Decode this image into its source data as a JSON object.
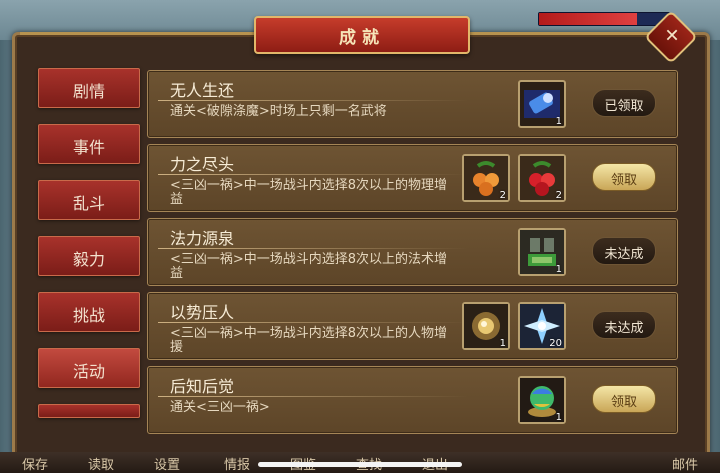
{
  "panel": {
    "title": "成就",
    "close_label": "✕"
  },
  "tabs": [
    {
      "label": "剧情",
      "active": false
    },
    {
      "label": "事件",
      "active": false
    },
    {
      "label": "乱斗",
      "active": false
    },
    {
      "label": "毅力",
      "active": false
    },
    {
      "label": "挑战",
      "active": false
    },
    {
      "label": "活动",
      "active": true
    }
  ],
  "achievements": [
    {
      "title": "无人生还",
      "desc": "通关<破隙涤魔>时场上只剩一名武将",
      "rewards": [
        {
          "icon": "blue-scroll-icon",
          "qty": "1"
        }
      ],
      "status": "已领取"
    },
    {
      "title": "力之尽头",
      "desc": "<三凶一祸>中一场战斗内选择8次以上的物理增益",
      "rewards": [
        {
          "icon": "orange-fruit-icon",
          "qty": "2"
        },
        {
          "icon": "red-fruit-icon",
          "qty": "2"
        }
      ],
      "status": "领取"
    },
    {
      "title": "法力源泉",
      "desc": "<三凶一祸>中一场战斗内选择8次以上的法术增益",
      "rewards": [
        {
          "icon": "green-armor-icon",
          "qty": "1"
        }
      ],
      "status": "未达成"
    },
    {
      "title": "以势压人",
      "desc": "<三凶一祸>中一场战斗内选择8次以上的人物增援",
      "rewards": [
        {
          "icon": "golden-orb-icon",
          "qty": "1"
        },
        {
          "icon": "ice-crystal-icon",
          "qty": "20"
        }
      ],
      "status": "未达成"
    },
    {
      "title": "后知后觉",
      "desc": "通关<三凶一祸>",
      "rewards": [
        {
          "icon": "rainbow-orb-icon",
          "qty": "1"
        }
      ],
      "status": "领取"
    }
  ],
  "bottom_bar": [
    "保存",
    "读取",
    "设置",
    "情报",
    "图鉴",
    "查找",
    "退出",
    "邮件"
  ],
  "colors": {
    "accent": "#c63c2b",
    "gold": "#b8934f"
  }
}
